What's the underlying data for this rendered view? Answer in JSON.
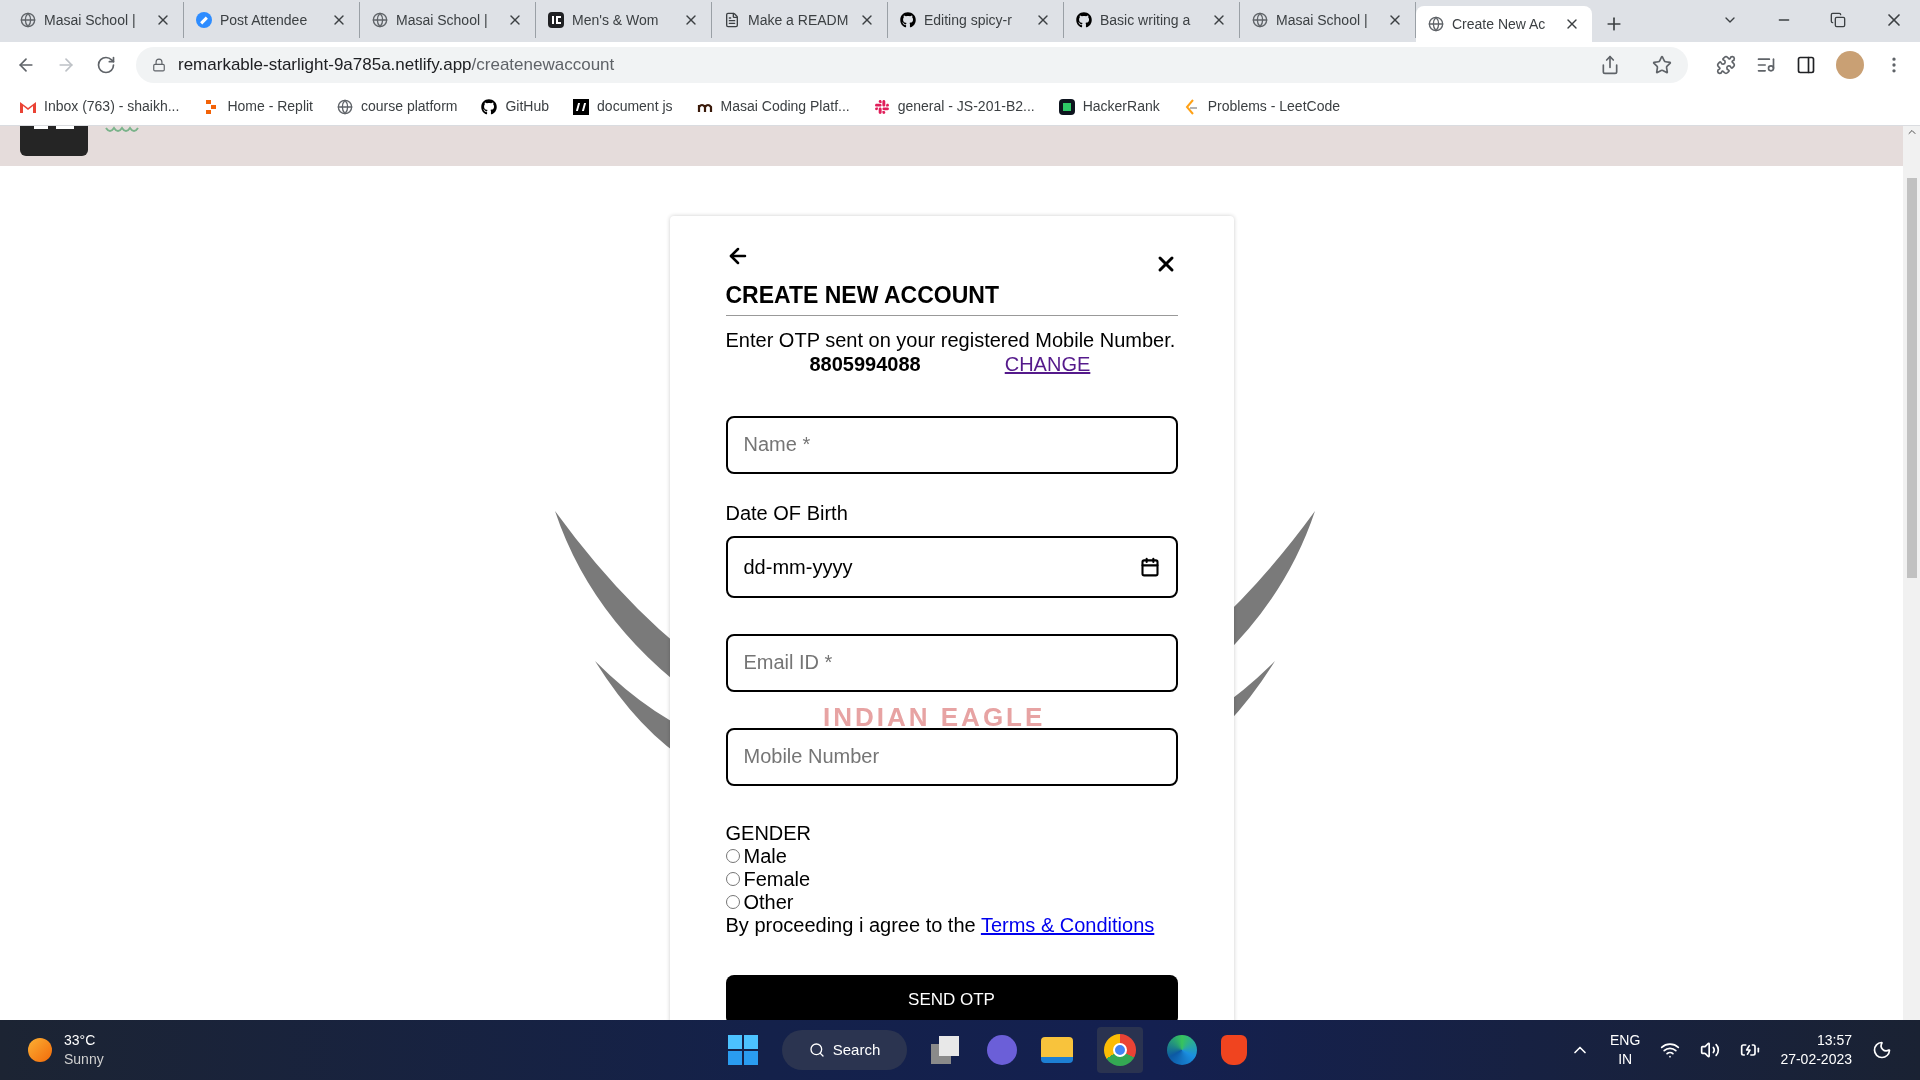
{
  "browser": {
    "tabs": [
      {
        "title": "Masai School |",
        "kind": "globe",
        "selected": false
      },
      {
        "title": "Post Attendee",
        "kind": "zoom",
        "selected": false
      },
      {
        "title": "Masai School |",
        "kind": "globe",
        "selected": false
      },
      {
        "title": "Men's & Wom",
        "kind": "ie",
        "selected": false
      },
      {
        "title": "Make a READM",
        "kind": "doc",
        "selected": false
      },
      {
        "title": "Editing spicy-r",
        "kind": "github",
        "selected": false
      },
      {
        "title": "Basic writing a",
        "kind": "github",
        "selected": false
      },
      {
        "title": "Masai School |",
        "kind": "globe",
        "selected": false
      },
      {
        "title": "Create New Ac",
        "kind": "globe",
        "selected": true
      }
    ],
    "address": {
      "host": "remarkable-starlight-9a785a.netlify.app",
      "path": "/createnewaccount"
    },
    "bookmarks": [
      {
        "label": "Inbox (763) - shaikh...",
        "kind": "gmail"
      },
      {
        "label": "Home - Replit",
        "kind": "replit"
      },
      {
        "label": "course platform",
        "kind": "globe"
      },
      {
        "label": "GitHub",
        "kind": "github"
      },
      {
        "label": "document js",
        "kind": "mbox"
      },
      {
        "label": "Masai Coding Platf...",
        "kind": "mletter"
      },
      {
        "label": "general - JS-201-B2...",
        "kind": "slack"
      },
      {
        "label": "HackerRank",
        "kind": "hackerrank"
      },
      {
        "label": "Problems - LeetCode",
        "kind": "leetcode"
      }
    ]
  },
  "page": {
    "background_caption": "INDIAN EAGLE",
    "form": {
      "title": "CREATE NEW ACCOUNT",
      "instruction": "Enter OTP sent on your registered Mobile Number.",
      "phone": "8805994088",
      "change_link": "CHANGE",
      "fields": [
        {
          "kind": "text",
          "placeholder": "Name *"
        },
        {
          "kind": "date",
          "label": "Date OF Birth",
          "placeholder": "dd-mm-yyyy"
        },
        {
          "kind": "text",
          "placeholder": "Email ID *"
        },
        {
          "kind": "text",
          "placeholder": "Mobile Number"
        }
      ],
      "gender": {
        "label": "GENDER",
        "options": [
          {
            "label": "Male",
            "selected": false
          },
          {
            "label": "Female",
            "selected": false
          },
          {
            "label": "Other",
            "selected": false
          }
        ]
      },
      "terms": {
        "text": "By proceeding i agree to the",
        "link": "Terms & Conditions"
      },
      "submit": "SEND OTP"
    }
  },
  "taskbar": {
    "weather": {
      "temp": "33°C",
      "condition": "Sunny"
    },
    "search": "Search",
    "language": [
      "ENG",
      "IN"
    ],
    "time": "13:57",
    "date": "27-02-2023"
  }
}
